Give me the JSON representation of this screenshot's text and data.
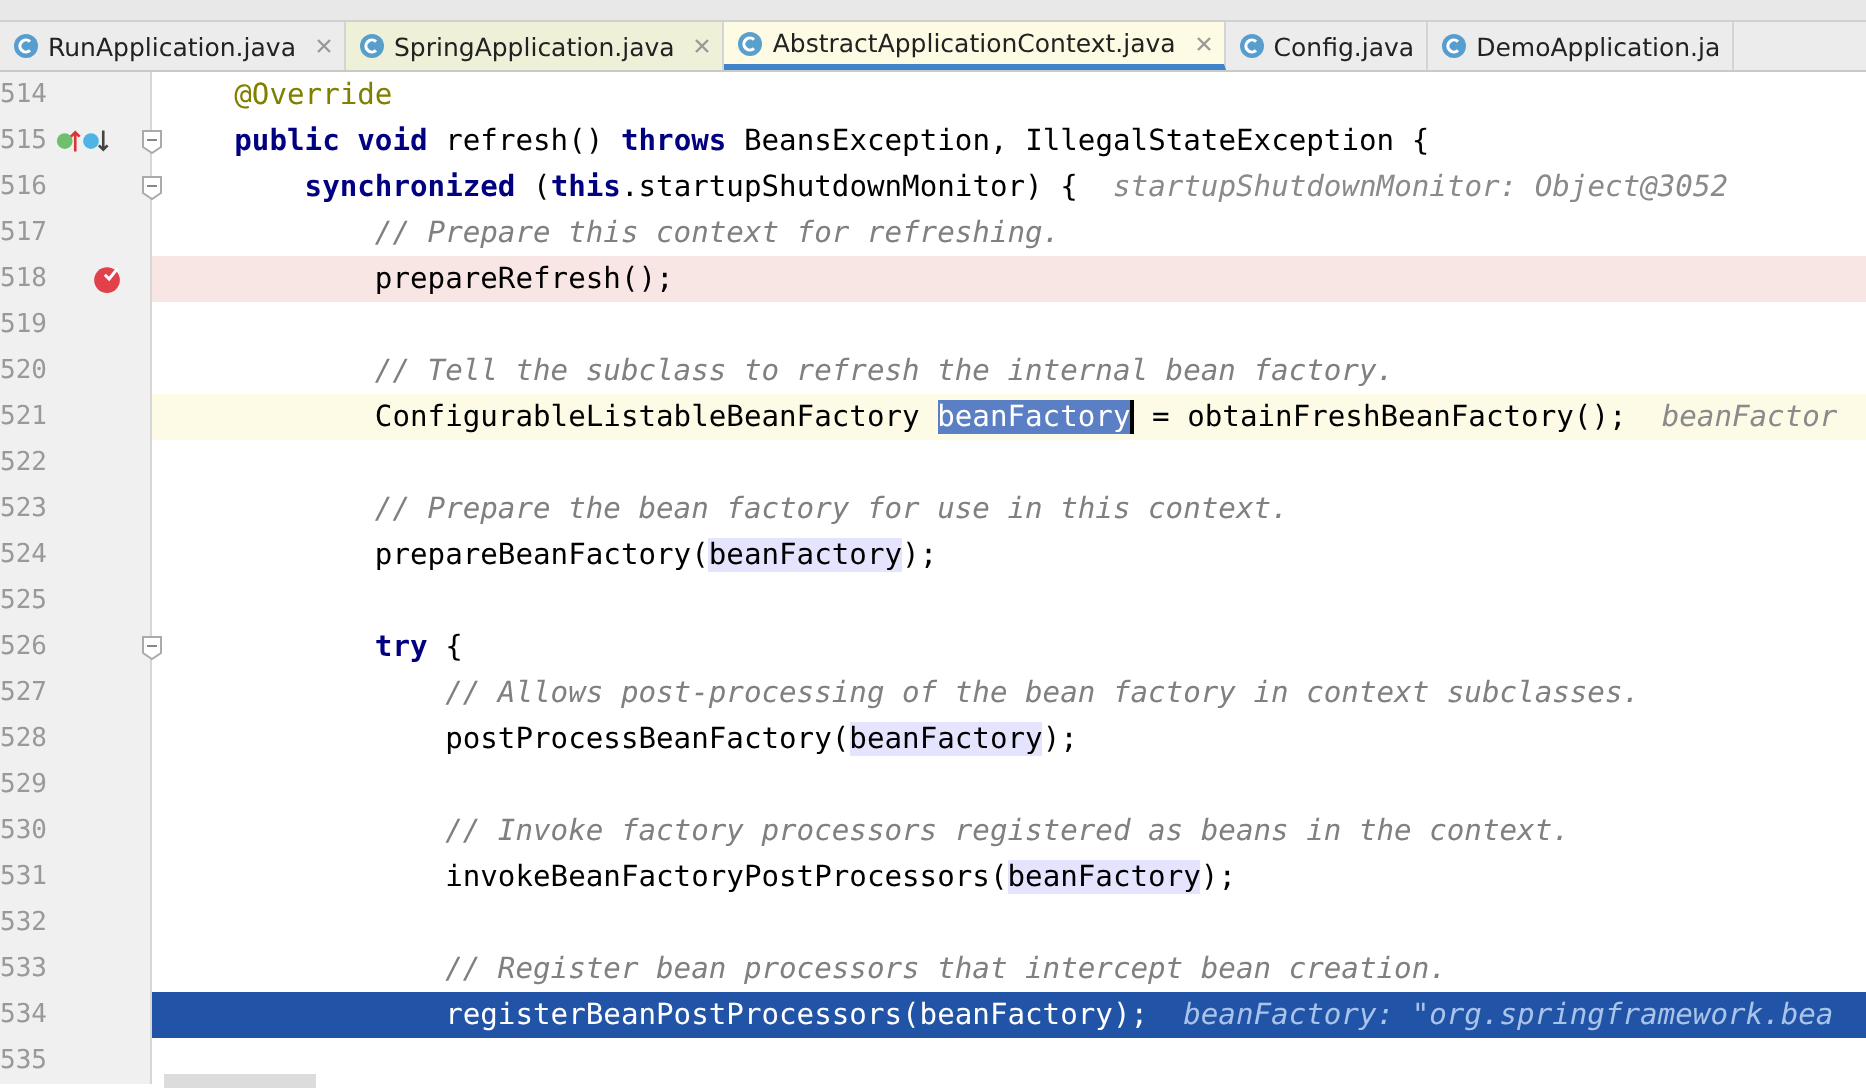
{
  "tabs": [
    {
      "label": "RunApplication.java",
      "selected": false,
      "closable": true,
      "tint": false
    },
    {
      "label": "SpringApplication.java",
      "selected": false,
      "closable": true,
      "tint": true
    },
    {
      "label": "AbstractApplicationContext.java",
      "selected": true,
      "closable": true,
      "tint": true
    },
    {
      "label": "Config.java",
      "selected": false,
      "closable": false,
      "tint": false
    },
    {
      "label": "DemoApplication.ja",
      "selected": false,
      "closable": false,
      "tint": false
    }
  ],
  "lines": [
    {
      "number": "514",
      "kind": "normal",
      "fold": false,
      "tokens": [
        {
          "kind": "ann",
          "text": "    @Override"
        }
      ]
    },
    {
      "number": "515",
      "kind": "normal",
      "fold": true,
      "marker": {
        "kind": "override"
      },
      "tokens": [
        {
          "kind": "kw",
          "text": "    public void "
        },
        {
          "kind": "plain",
          "text": "refresh() "
        },
        {
          "kind": "kw",
          "text": "throws "
        },
        {
          "kind": "plain",
          "text": "BeansException, IllegalStateException {"
        }
      ]
    },
    {
      "number": "516",
      "kind": "normal",
      "fold": true,
      "tokens": [
        {
          "kind": "kw",
          "text": "        synchronized "
        },
        {
          "kind": "plain",
          "text": "("
        },
        {
          "kind": "kw",
          "text": "this"
        },
        {
          "kind": "plain",
          "text": ".startupShutdownMonitor) {"
        },
        {
          "kind": "hint",
          "text": "  startupShutdownMonitor: Object@3052"
        }
      ]
    },
    {
      "number": "517",
      "kind": "normal",
      "fold": false,
      "tokens": [
        {
          "kind": "comment",
          "text": "            // Prepare this context for refreshing."
        }
      ]
    },
    {
      "number": "518",
      "kind": "breakpoint",
      "fold": false,
      "marker": {
        "kind": "breakpoint"
      },
      "tokens": [
        {
          "kind": "plain",
          "text": "            prepareRefresh();"
        }
      ]
    },
    {
      "number": "519",
      "kind": "normal",
      "fold": false
    },
    {
      "number": "520",
      "kind": "normal",
      "fold": false,
      "tokens": [
        {
          "kind": "comment",
          "text": "            // Tell the subclass to refresh the internal bean factory."
        }
      ]
    },
    {
      "number": "521",
      "kind": "current",
      "fold": false,
      "tokens": [
        {
          "kind": "plain",
          "text": "            ConfigurableListableBeanFactory "
        },
        {
          "kind": "selection",
          "text": "beanFactory"
        },
        {
          "kind": "plain",
          "text": " = obtainFreshBeanFactory();"
        },
        {
          "kind": "hint",
          "text": "  beanFactor"
        }
      ]
    },
    {
      "number": "522",
      "kind": "normal",
      "fold": false
    },
    {
      "number": "523",
      "kind": "normal",
      "fold": false,
      "tokens": [
        {
          "kind": "comment",
          "text": "            // Prepare the bean factory for use in this context."
        }
      ]
    },
    {
      "number": "524",
      "kind": "normal",
      "fold": false,
      "tokens": [
        {
          "kind": "plain",
          "text": "            prepareBeanFactory("
        },
        {
          "kind": "usage",
          "text": "beanFactory"
        },
        {
          "kind": "plain",
          "text": ");"
        }
      ]
    },
    {
      "number": "525",
      "kind": "normal",
      "fold": false
    },
    {
      "number": "526",
      "kind": "normal",
      "fold": true,
      "tokens": [
        {
          "kind": "kw",
          "text": "            try "
        },
        {
          "kind": "plain",
          "text": "{"
        }
      ]
    },
    {
      "number": "527",
      "kind": "normal",
      "fold": false,
      "tokens": [
        {
          "kind": "comment",
          "text": "                // Allows post-processing of the bean factory in context subclasses."
        }
      ]
    },
    {
      "number": "528",
      "kind": "normal",
      "fold": false,
      "tokens": [
        {
          "kind": "plain",
          "text": "                postProcessBeanFactory("
        },
        {
          "kind": "usage",
          "text": "beanFactory"
        },
        {
          "kind": "plain",
          "text": ");"
        }
      ]
    },
    {
      "number": "529",
      "kind": "normal",
      "fold": false
    },
    {
      "number": "530",
      "kind": "normal",
      "fold": false,
      "tokens": [
        {
          "kind": "comment",
          "text": "                // Invoke factory processors registered as beans in the context."
        }
      ]
    },
    {
      "number": "531",
      "kind": "normal",
      "fold": false,
      "tokens": [
        {
          "kind": "plain",
          "text": "                invokeBeanFactoryPostProcessors("
        },
        {
          "kind": "usage",
          "text": "beanFactory"
        },
        {
          "kind": "plain",
          "text": ");"
        }
      ]
    },
    {
      "number": "532",
      "kind": "normal",
      "fold": false
    },
    {
      "number": "533",
      "kind": "normal",
      "fold": false,
      "tokens": [
        {
          "kind": "comment",
          "text": "                // Register bean processors that intercept bean creation."
        }
      ]
    },
    {
      "number": "534",
      "kind": "execution",
      "fold": false,
      "tokens": [
        {
          "kind": "plain",
          "text": "                registerBeanPostProcessors(beanFactory);"
        },
        {
          "kind": "hint",
          "text": "  beanFactory: \"org.springframework.bea"
        }
      ]
    },
    {
      "number": "535",
      "kind": "normal",
      "fold": false
    }
  ]
}
